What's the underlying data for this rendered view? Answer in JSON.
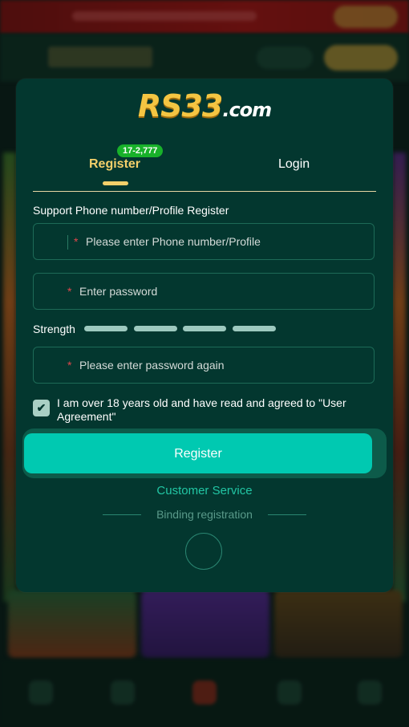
{
  "logo": {
    "brand": "RS33",
    "domain": ".com"
  },
  "tabs": {
    "register_label": "Register",
    "login_label": "Login",
    "register_badge": "17-2,777"
  },
  "form": {
    "section_label": "Support Phone number/Profile Register",
    "phone_placeholder": "Please enter Phone number/Profile",
    "password_placeholder": "Enter password",
    "strength_label": "Strength",
    "strength_levels": 4,
    "confirm_placeholder": "Please enter password again",
    "required_mark": "*",
    "agreement_text": "I am over 18 years old and have read and agreed to \"User Agreement\"",
    "agreement_checked": true
  },
  "actions": {
    "register_button": "Register",
    "customer_service": "Customer Service",
    "binding_registration": "Binding registration"
  },
  "colors": {
    "accent": "#00c9b1",
    "tab_active": "#f4cf6a",
    "modal_bg": "#03372f",
    "badge": "#18b12a",
    "required": "#e0474c"
  }
}
